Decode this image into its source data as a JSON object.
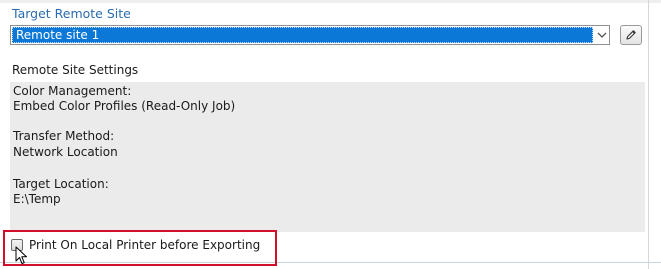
{
  "target_site": {
    "heading": "Target Remote Site",
    "selected_value": "Remote site 1"
  },
  "settings": {
    "heading": "Remote Site Settings",
    "lines": [
      "Color Management:",
      "Embed Color Profiles (Read-Only Job)",
      "",
      "Transfer Method:",
      "Network Location",
      "",
      "Target Location:",
      "E:\\Temp"
    ]
  },
  "print_option": {
    "label": "Print On Local Printer before Exporting",
    "checked": false
  },
  "icons": {
    "dropdown": "chevron-down-icon",
    "edit": "pencil-icon",
    "cursor": "mouse-pointer-icon"
  },
  "colors": {
    "heading": "#2a6cb0",
    "selection": "#0b78d7",
    "highlight": "#d0102c",
    "panel": "#ebebeb"
  }
}
